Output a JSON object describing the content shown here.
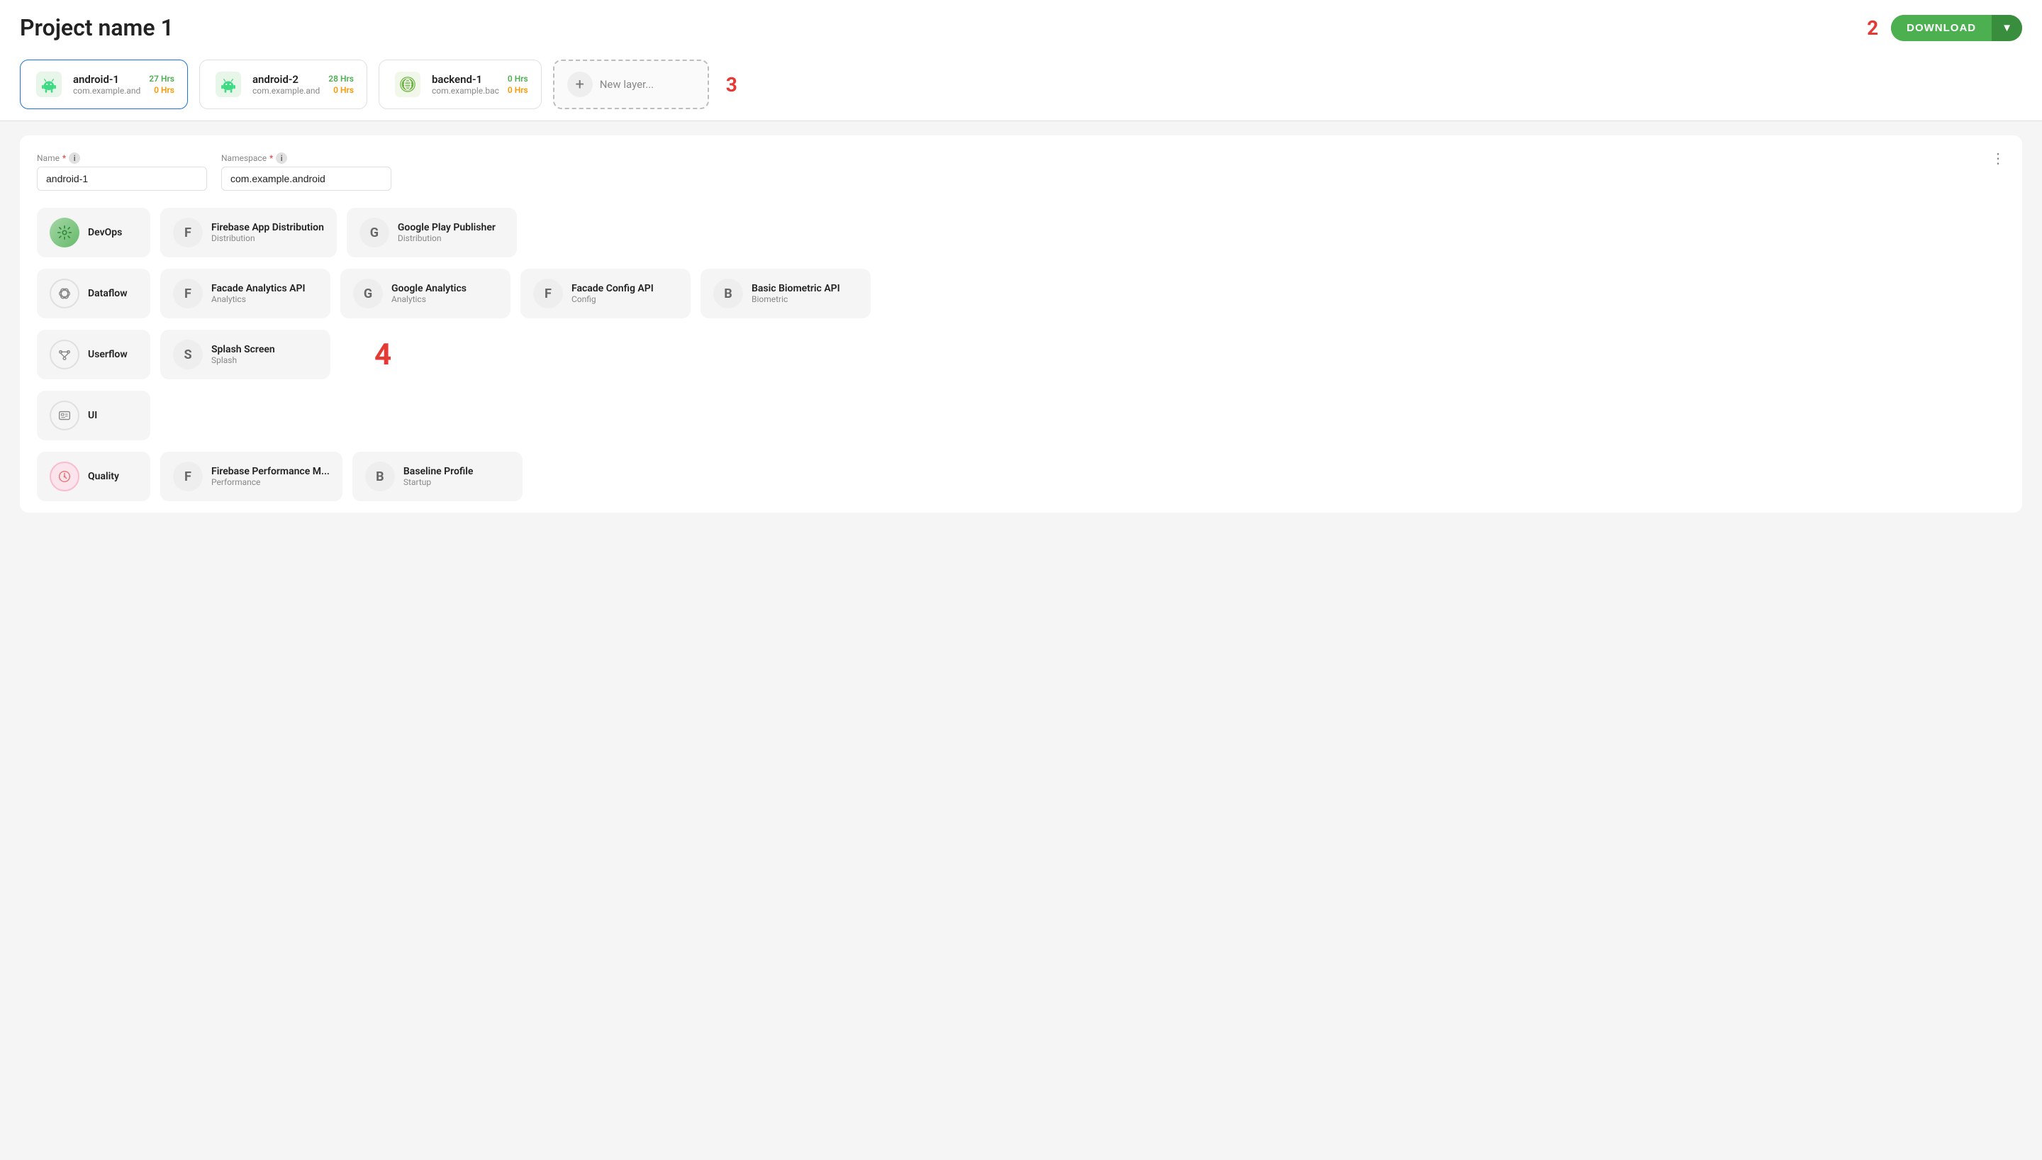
{
  "header": {
    "title": "Project name",
    "title_num": "1",
    "num_badge": "2",
    "download_label": "DOWNLOAD"
  },
  "layers": [
    {
      "id": "android-1",
      "name": "android-1",
      "namespace": "com.example.and",
      "hrs1": "27 Hrs",
      "hrs2": "0 Hrs",
      "type": "android",
      "active": true
    },
    {
      "id": "android-2",
      "name": "android-2",
      "namespace": "com.example.and",
      "hrs1": "28 Hrs",
      "hrs2": "0 Hrs",
      "type": "android",
      "active": false
    },
    {
      "id": "backend-1",
      "name": "backend-1",
      "namespace": "com.example.bac",
      "hrs1": "0 Hrs",
      "hrs2": "0 Hrs",
      "type": "spring",
      "active": false
    },
    {
      "id": "new-layer",
      "name": "New layer...",
      "type": "new"
    }
  ],
  "new_layer_num": "3",
  "fields": {
    "name_label": "Name",
    "name_value": "android-1",
    "namespace_label": "Namespace",
    "namespace_value": "com.example.android"
  },
  "modules": {
    "num4": "4",
    "categories": [
      {
        "id": "devops",
        "name": "DevOps",
        "icon_type": "devops"
      },
      {
        "id": "dataflow",
        "name": "Dataflow",
        "icon_type": "dataflow"
      },
      {
        "id": "userflow",
        "name": "Userflow",
        "icon_type": "userflow"
      },
      {
        "id": "ui",
        "name": "UI",
        "icon_type": "ui"
      },
      {
        "id": "quality",
        "name": "Quality",
        "icon_type": "quality"
      }
    ],
    "items_row1": [
      {
        "letter": "F",
        "name": "Firebase App Distribution",
        "sub": "Distribution"
      },
      {
        "letter": "G",
        "name": "Google Play Publisher",
        "sub": "Distribution"
      }
    ],
    "items_row2": [
      {
        "letter": "F",
        "name": "Facade Analytics API",
        "sub": "Analytics"
      },
      {
        "letter": "G",
        "name": "Google Analytics",
        "sub": "Analytics"
      },
      {
        "letter": "F",
        "name": "Facade Config API",
        "sub": "Config"
      },
      {
        "letter": "B",
        "name": "Basic Biometric API",
        "sub": "Biometric"
      }
    ],
    "items_row3": [
      {
        "letter": "S",
        "name": "Splash Screen",
        "sub": "Splash"
      }
    ],
    "items_row5": [
      {
        "letter": "F",
        "name": "Firebase Performance M...",
        "sub": "Performance"
      },
      {
        "letter": "B",
        "name": "Baseline Profile",
        "sub": "Startup"
      }
    ]
  }
}
